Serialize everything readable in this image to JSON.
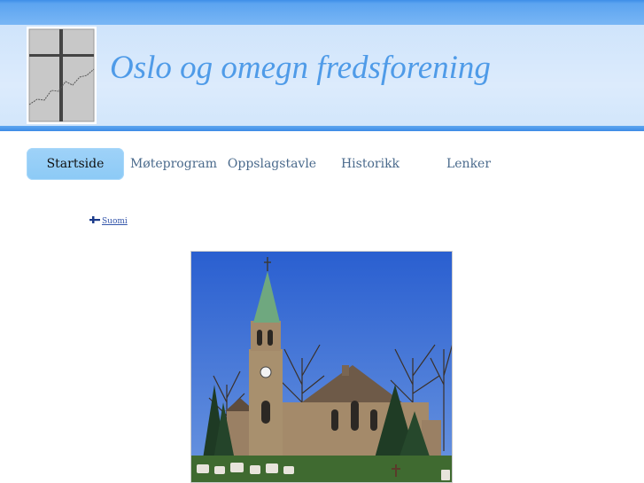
{
  "header": {
    "title": "Oslo og omegn fredsforening",
    "logo_icon": "cross-logo-icon"
  },
  "nav": {
    "items": [
      {
        "label": "Startside",
        "active": true
      },
      {
        "label": "Møteprogram",
        "active": false
      },
      {
        "label": "Oppslagstavle",
        "active": false
      },
      {
        "label": "Historikk",
        "active": false
      },
      {
        "label": "Lenker",
        "active": false
      }
    ]
  },
  "language": {
    "label": "Suomi",
    "flag_icon": "finland-flag-icon"
  },
  "main": {
    "photo_icon": "church-photo"
  },
  "colors": {
    "title": "#4f9be8",
    "header_band": "#79b6f5",
    "nav_active": "#9fd2f8",
    "nav_text": "#4a6a8c"
  }
}
